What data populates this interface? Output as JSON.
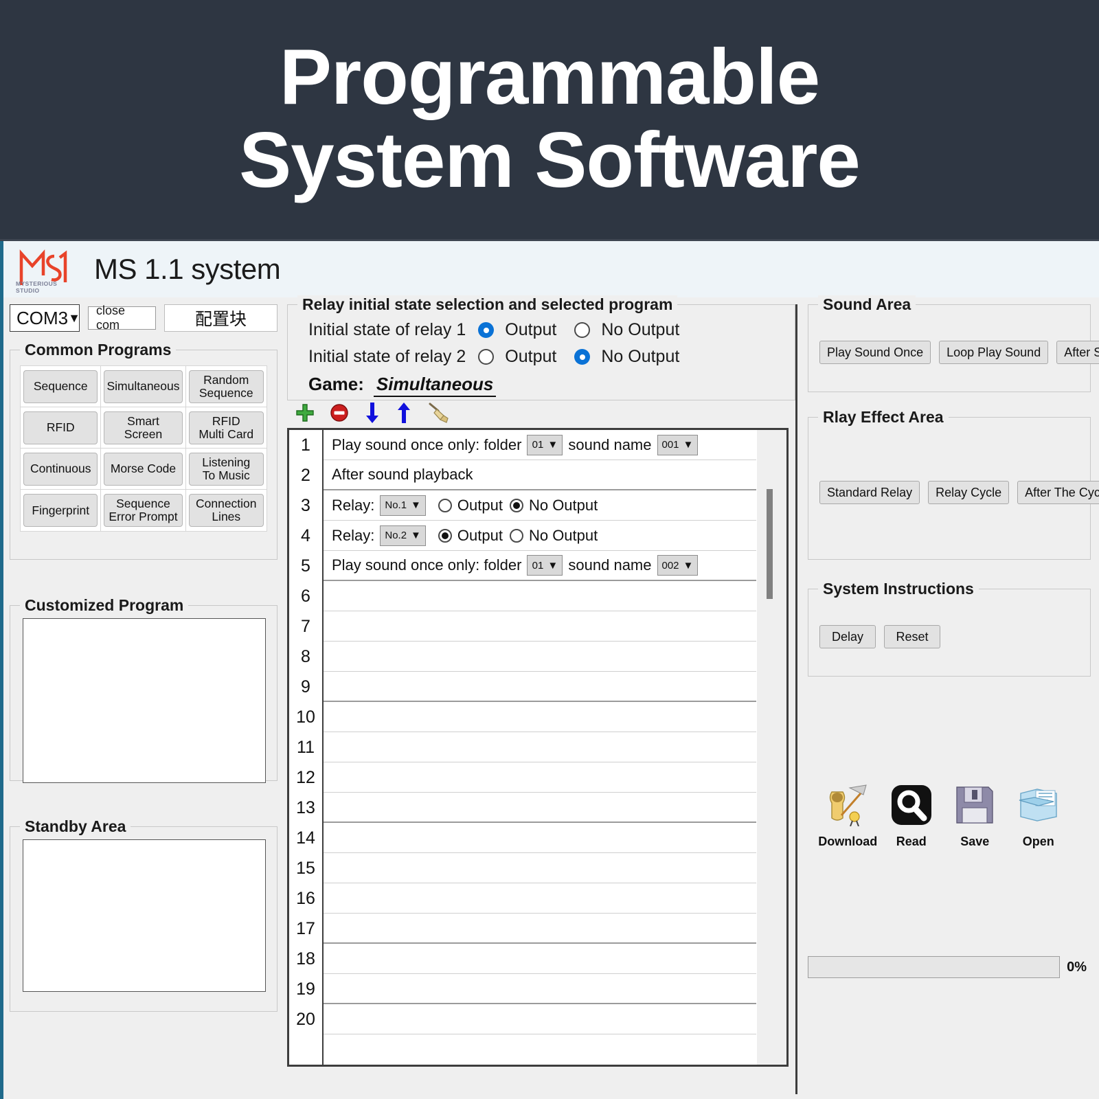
{
  "banner": {
    "line1": "Programmable",
    "line2": "System Software"
  },
  "titlebar": {
    "app_title": "MS 1.1 system",
    "logo_subtitle": "MYSTERIOUS STUDIO"
  },
  "toolbar_top": {
    "port_value": "COM3",
    "caret": "▼",
    "close_com": "close com",
    "config_block": "配置块"
  },
  "common_programs": {
    "title": "Common Programs",
    "buttons": [
      "Sequence",
      "Simultaneous",
      "Random\nSequence",
      "RFID",
      "Smart\nScreen",
      "RFID\nMulti Card",
      "Continuous",
      "Morse Code",
      "Listening\nTo Music",
      "Fingerprint",
      "Sequence\nError Prompt",
      "Connection\nLines"
    ]
  },
  "customized_program": {
    "title": "Customized Program"
  },
  "standby_area": {
    "title": "Standby Area"
  },
  "relay_state": {
    "title": "Relay initial state selection and selected program",
    "relay1_label": "Initial state of relay 1",
    "relay2_label": "Initial state of relay 2",
    "output_label": "Output",
    "no_output_label": "No Output",
    "relay1_selected": "Output",
    "relay2_selected": "No Output",
    "game_label": "Game:",
    "game_value": "Simultaneous"
  },
  "list_toolbar": {
    "add": "add-icon",
    "remove": "remove-icon",
    "move_down": "arrow-down-icon",
    "move_up": "arrow-up-icon",
    "clear": "broom-icon"
  },
  "program_list": {
    "row_numbers": [
      "1",
      "2",
      "3",
      "4",
      "5",
      "6",
      "7",
      "8",
      "9",
      "10",
      "11",
      "12",
      "13",
      "14",
      "15",
      "16",
      "17",
      "18",
      "19",
      "20"
    ],
    "rows": [
      {
        "n": "1",
        "kind": "sound",
        "prefix": "Play sound once only: folder",
        "folder": "01",
        "mid": "sound name",
        "sound": "001"
      },
      {
        "n": "2",
        "kind": "text",
        "text": "After sound playback"
      },
      {
        "n": "3",
        "kind": "relay",
        "prefix": "Relay:",
        "relay": "No.1",
        "output_label": "Output",
        "no_output_label": "No Output",
        "selected": "No Output"
      },
      {
        "n": "4",
        "kind": "relay",
        "prefix": "Relay:",
        "relay": "No.2",
        "output_label": "Output",
        "no_output_label": "No Output",
        "selected": "Output"
      },
      {
        "n": "5",
        "kind": "sound",
        "prefix": "Play sound once only: folder",
        "folder": "01",
        "mid": "sound name",
        "sound": "002"
      },
      {
        "n": "6",
        "kind": "empty"
      },
      {
        "n": "7",
        "kind": "empty"
      },
      {
        "n": "8",
        "kind": "empty"
      },
      {
        "n": "9",
        "kind": "empty"
      },
      {
        "n": "10",
        "kind": "empty"
      },
      {
        "n": "11",
        "kind": "empty"
      },
      {
        "n": "12",
        "kind": "empty"
      },
      {
        "n": "13",
        "kind": "empty"
      },
      {
        "n": "14",
        "kind": "empty"
      },
      {
        "n": "15",
        "kind": "empty"
      },
      {
        "n": "16",
        "kind": "empty"
      },
      {
        "n": "17",
        "kind": "empty"
      },
      {
        "n": "18",
        "kind": "empty"
      },
      {
        "n": "19",
        "kind": "empty"
      },
      {
        "n": "20",
        "kind": "empty"
      }
    ]
  },
  "sound_area": {
    "title": "Sound Area",
    "buttons": [
      "Play Sound Once",
      "Loop Play Sound",
      "After Sound Play"
    ]
  },
  "relay_effect_area": {
    "title": "Rlay Effect Area",
    "buttons": [
      "Standard Relay",
      "Relay Cycle",
      "After The Cycle Relay"
    ]
  },
  "system_instructions": {
    "title": "System Instructions",
    "buttons": [
      "Delay",
      "Reset"
    ]
  },
  "file_actions": [
    {
      "label": "Download",
      "icon": "scroll-quill-icon"
    },
    {
      "label": "Read",
      "icon": "magnifier-icon"
    },
    {
      "label": "Save",
      "icon": "floppy-disk-icon"
    },
    {
      "label": "Open",
      "icon": "folder-open-icon"
    }
  ],
  "progress": {
    "percent_label": "0%"
  },
  "colors": {
    "banner_bg": "#2e3642",
    "accent_blue": "#0a72d6",
    "panel_bg": "#efefef"
  }
}
